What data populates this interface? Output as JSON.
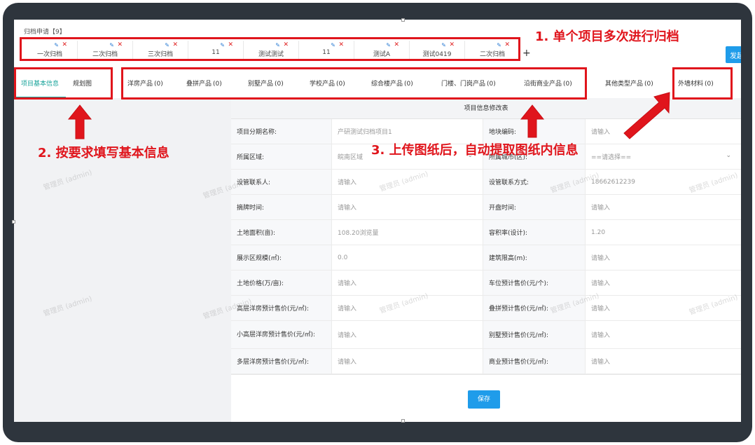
{
  "breadcrumb": "归档申请【9】",
  "archive_tabs": [
    "一次归档",
    "二次归档",
    "三次归档",
    "11",
    "测试测试",
    "11",
    "测试A",
    "测试0419",
    "二次归档"
  ],
  "add_tab_symbol": "+",
  "publish_button": "发起",
  "left_tabs": [
    "项目基本信息",
    "规划图"
  ],
  "product_tabs": [
    {
      "label": "洋房产品",
      "count": "(0)"
    },
    {
      "label": "叠拼产品",
      "count": "(0)"
    },
    {
      "label": "别墅产品",
      "count": "(0)"
    },
    {
      "label": "学校产品",
      "count": "(0)"
    },
    {
      "label": "综合楼产品",
      "count": "(0)"
    },
    {
      "label": "门楼、门岗产品",
      "count": "(0)"
    },
    {
      "label": "沿街商业产品",
      "count": "(0)"
    },
    {
      "label": "其他类型产品",
      "count": "(0)"
    },
    {
      "label": "外墙材料",
      "count": "(0)"
    }
  ],
  "form": {
    "title": "项目信息修改表",
    "rows": [
      {
        "l1": "项目分期名称:",
        "v1": "产研测试归档项目1",
        "l2": "地块编码:",
        "v2": "请输入"
      },
      {
        "l1": "所属区域:",
        "v1": "皖南区域",
        "l2": "所属城市(区):",
        "v2": "==请选择=="
      },
      {
        "l1": "设管联系人:",
        "v1": "请输入",
        "l2": "设管联系方式:",
        "v2": "18662612239"
      },
      {
        "l1": "摘牌时间:",
        "v1": "请输入",
        "l2": "开盘时间:",
        "v2": "请输入"
      },
      {
        "l1": "土地面积(亩):",
        "v1": "108.20浏览量",
        "l2": "容积率(设计):",
        "v2": "1.20"
      },
      {
        "l1": "展示区规模(㎡):",
        "v1": "0.0",
        "l2": "建筑限高(m):",
        "v2": "请输入"
      },
      {
        "l1": "土地价格(万/亩):",
        "v1": "请输入",
        "l2": "车位预计售价(元/个):",
        "v2": "请输入"
      },
      {
        "l1": "高层洋房预计售价(元/㎡):",
        "v1": "请输入",
        "l2": "叠拼预计售价(元/㎡):",
        "v2": "请输入"
      },
      {
        "l1": "小高层洋房预计售价(元/㎡):",
        "v1": "请输入",
        "l2": "别墅预计售价(元/㎡):",
        "v2": "请输入"
      },
      {
        "l1": "多层洋房预计售价(元/㎡):",
        "v1": "请输入",
        "l2": "商业预计售价(元/㎡):",
        "v2": "请输入"
      }
    ],
    "save_label": "保存"
  },
  "watermark": "管理员 (admin)",
  "annotations": {
    "a1": "1. 单个项目多次进行归档",
    "a2": "2. 按要求填写基本信息",
    "a3": "3. 上传图纸后，自动提取图纸内信息"
  },
  "colors": {
    "accent": "#1f9cea",
    "active_tab": "#17a39a",
    "annotation": "#e0151c",
    "frame": "#2e353d"
  }
}
